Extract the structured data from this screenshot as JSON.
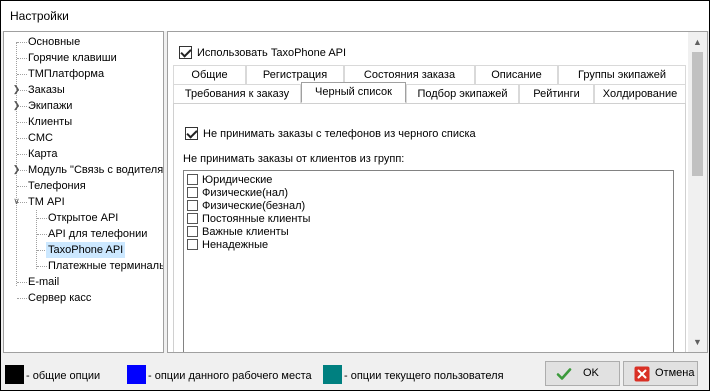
{
  "window": {
    "title": "Настройки"
  },
  "tree": {
    "items": [
      {
        "label": "Основные"
      },
      {
        "label": "Горячие клавиши"
      },
      {
        "label": "ТМПлатформа"
      },
      {
        "label": "Заказы"
      },
      {
        "label": "Экипажи"
      },
      {
        "label": "Клиенты"
      },
      {
        "label": "СМС"
      },
      {
        "label": "Карта"
      },
      {
        "label": "Модуль \"Связь с водителя"
      },
      {
        "label": "Телефония"
      },
      {
        "label": "ТМ API"
      },
      {
        "label": "Открытое API"
      },
      {
        "label": "API для телефонии"
      },
      {
        "label": "TaxoPhone API"
      },
      {
        "label": "Платежные терминалы"
      },
      {
        "label": "E-mail"
      },
      {
        "label": "Сервер касс"
      }
    ],
    "selected": "TaxoPhone API"
  },
  "content": {
    "use_api_label": "Использовать TaxoPhone API",
    "use_api_checked": true,
    "tabs_row1": [
      {
        "label": "Общие"
      },
      {
        "label": "Регистрация"
      },
      {
        "label": "Состояния заказа"
      },
      {
        "label": "Описание"
      },
      {
        "label": "Группы экипажей"
      }
    ],
    "tabs_row2": [
      {
        "label": "Требования к заказу"
      },
      {
        "label": "Черный список"
      },
      {
        "label": "Подбор экипажей"
      },
      {
        "label": "Рейтинги"
      },
      {
        "label": "Холдирование"
      }
    ],
    "active_tab": "Черный список",
    "block_blacklist_label": "Не принимать заказы с телефонов из черного списка",
    "block_blacklist_checked": true,
    "groups_label": "Не принимать заказы от клиентов из групп:",
    "groups": [
      {
        "label": "Юридические",
        "checked": false
      },
      {
        "label": "Физические(нал)",
        "checked": false
      },
      {
        "label": "Физические(безнал)",
        "checked": false
      },
      {
        "label": "Постоянные клиенты",
        "checked": false
      },
      {
        "label": "Важные клиенты",
        "checked": false
      },
      {
        "label": "Ненадежные",
        "checked": false
      }
    ]
  },
  "legend": {
    "common": {
      "text": "- общие опции",
      "color": "#000000"
    },
    "workplace": {
      "text": "- опции данного рабочего места",
      "color": "#0000ff"
    },
    "user": {
      "text": "- опции текущего пользователя",
      "color": "#008080"
    }
  },
  "buttons": {
    "ok": {
      "label": "OK",
      "icon": "checkmark-icon",
      "icon_color": "#3c9a3c"
    },
    "cancel": {
      "label": "Отмена",
      "icon": "close-icon",
      "icon_color": "#d93025"
    }
  }
}
